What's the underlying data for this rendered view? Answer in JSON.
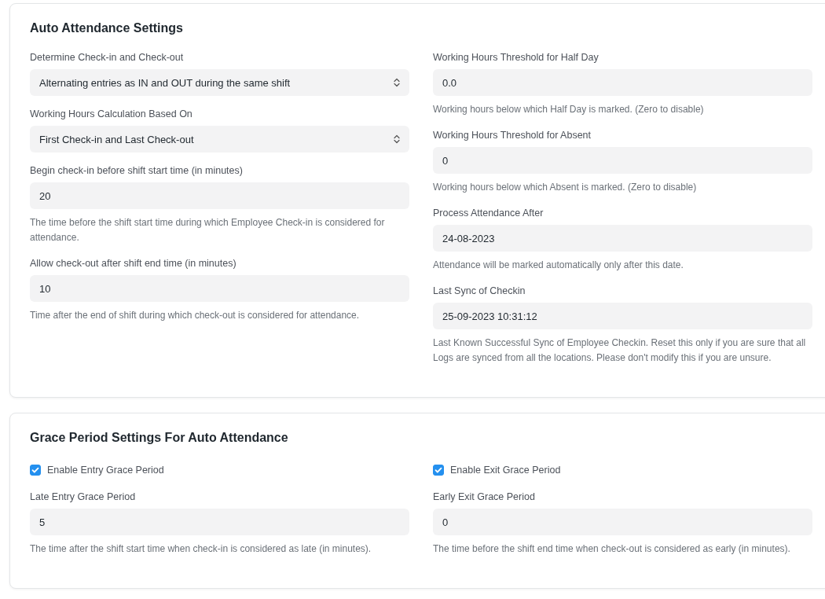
{
  "sections": [
    {
      "title": "Auto Attendance Settings",
      "columns": [
        [
          {
            "kind": "select",
            "label": "Determine Check-in and Check-out",
            "value": "Alternating entries as IN and OUT during the same shift"
          },
          {
            "kind": "select",
            "label": "Working Hours Calculation Based On",
            "value": "First Check-in and Last Check-out"
          },
          {
            "kind": "input",
            "label": "Begin check-in before shift start time (in minutes)",
            "value": "20",
            "description": "The time before the shift start time during which Employee Check-in is considered for attendance."
          },
          {
            "kind": "input",
            "label": "Allow check-out after shift end time (in minutes)",
            "value": "10",
            "description": "Time after the end of shift during which check-out is considered for attendance."
          }
        ],
        [
          {
            "kind": "input",
            "label": "Working Hours Threshold for Half Day",
            "value": "0.0",
            "description": "Working hours below which Half Day is marked. (Zero to disable)"
          },
          {
            "kind": "input",
            "label": "Working Hours Threshold for Absent",
            "value": "0",
            "description": "Working hours below which Absent is marked. (Zero to disable)"
          },
          {
            "kind": "input",
            "label": "Process Attendance After",
            "value": "24-08-2023",
            "description": "Attendance will be marked automatically only after this date."
          },
          {
            "kind": "input",
            "label": "Last Sync of Checkin",
            "value": "25-09-2023 10:31:12",
            "description": "Last Known Successful Sync of Employee Checkin. Reset this only if you are sure that all Logs are synced from all the locations. Please don't modify this if you are unsure."
          }
        ]
      ]
    },
    {
      "title": "Grace Period Settings For Auto Attendance",
      "columns": [
        [
          {
            "kind": "checkbox",
            "label": "Enable Entry Grace Period",
            "checked": true
          },
          {
            "kind": "input",
            "label": "Late Entry Grace Period",
            "value": "5",
            "description": "The time after the shift start time when check-in is considered as late (in minutes)."
          }
        ],
        [
          {
            "kind": "checkbox",
            "label": "Enable Exit Grace Period",
            "checked": true
          },
          {
            "kind": "input",
            "label": "Early Exit Grace Period",
            "value": "0",
            "description": "The time before the shift end time when check-out is considered as early (in minutes)."
          }
        ]
      ]
    }
  ]
}
